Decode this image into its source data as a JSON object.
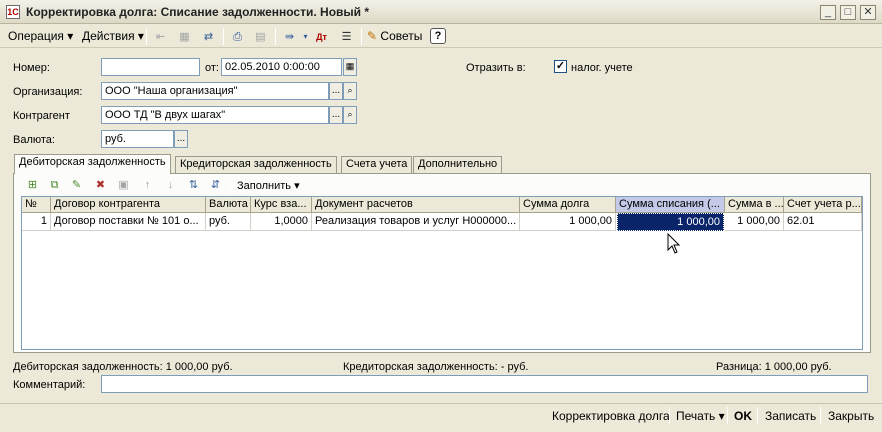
{
  "window": {
    "title": "Корректировка долга: Списание задолженности. Новый *",
    "icon": "document-app-icon",
    "controls": [
      "_",
      "□",
      "✕"
    ]
  },
  "toolbar": {
    "operation_label": "Операция",
    "actions_label": "Действия",
    "tips_label": "Советы",
    "help_label": "?",
    "dropdown_arrow": "▾"
  },
  "form": {
    "number_label": "Номер:",
    "number_value": "",
    "date_label": "от:",
    "date_value": "02.05.2010  0:00:00",
    "reflect_label": "Отразить в:",
    "tax_label": "налог. учете",
    "tax_checked": "✓",
    "org_label": "Организация:",
    "org_value": "ООО \"Наша организация\"",
    "contractor_label": "Контрагент",
    "contractor_value": "ООО ТД \"В двух шагах\"",
    "currency_label": "Валюта:",
    "currency_value": "руб.",
    "ellipsis": "...",
    "search_glyph": "🔍"
  },
  "tabs": [
    {
      "label": "Дебиторская задолженность"
    },
    {
      "label": "Кредиторская задолженность"
    },
    {
      "label": "Счета учета"
    },
    {
      "label": "Дополнительно"
    }
  ],
  "grid_toolbar": {
    "fill_label": "Заполнить"
  },
  "grid": {
    "columns": [
      "№",
      "Договор контрагента",
      "Валюта",
      "Курс вза...",
      "Документ расчетов",
      "Сумма долга",
      "Сумма списания (...",
      "Сумма в ...",
      "Счет учета р..."
    ],
    "rows": [
      [
        "1",
        "Договор поставки № 101 о...",
        "руб.",
        "1,0000",
        "Реализация товаров и услуг Н000000...",
        "1 000,00",
        "1 000,00",
        "1 000,00",
        "62.01"
      ]
    ]
  },
  "summary": {
    "debit": "Дебиторская задолженность: 1 000,00 руб.",
    "credit": "Кредиторская задолженность: - руб.",
    "difference": "Разница: 1 000,00 руб."
  },
  "comment": {
    "label": "Комментарий:",
    "value": ""
  },
  "bottom": {
    "debt_adjust_label": "Корректировка долга",
    "print_label": "Печать",
    "ok_label": "OK",
    "save_label": "Записать",
    "close_label": "Закрыть"
  }
}
